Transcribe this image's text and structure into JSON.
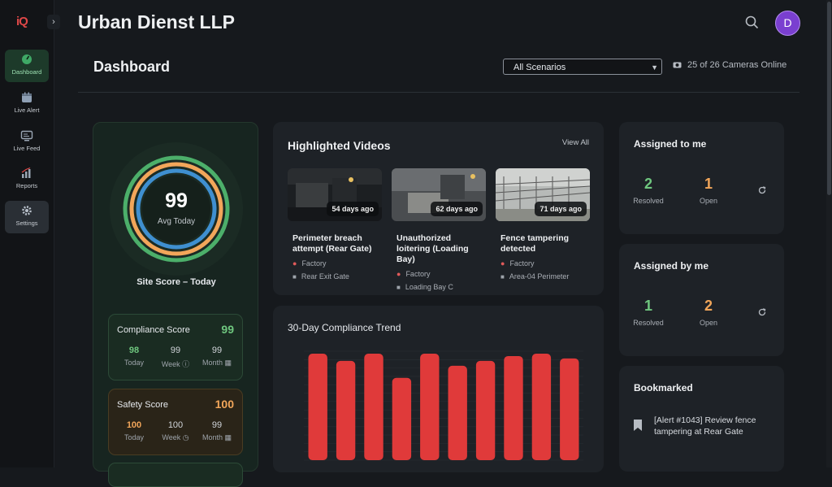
{
  "app": {
    "logo_text": "iQ",
    "company": "Urban Dienst LLP",
    "user_initial": "D"
  },
  "sidebar": {
    "items": [
      {
        "label": "Dashboard",
        "icon": "gauge-icon",
        "active": true
      },
      {
        "label": "Live Alert",
        "icon": "calendar-alert-icon"
      },
      {
        "label": "Live Feed",
        "icon": "monitor-icon"
      },
      {
        "label": "Reports",
        "icon": "bar-chart-icon"
      },
      {
        "label": "Settings",
        "icon": "gear-icon",
        "hover": true
      }
    ]
  },
  "page": {
    "title": "Dashboard",
    "scenario_selected": "All Scenarios",
    "cameras_online": "25 of 26 Cameras Online"
  },
  "site_score": {
    "value": "99",
    "sub": "Avg Today",
    "caption": "Site Score – Today",
    "rings": [
      {
        "color": "#4caf6a",
        "level": 0.99
      },
      {
        "color": "#f2a65a",
        "level": 1.0
      },
      {
        "color": "#3f8fd0",
        "level": 0.99
      }
    ]
  },
  "compliance": {
    "title": "Compliance Score",
    "value": "99",
    "today": "98",
    "today_label": "Today",
    "week": "99",
    "week_label": "Week",
    "month": "99",
    "month_label": "Month"
  },
  "safety": {
    "title": "Safety Score",
    "value": "100",
    "today": "100",
    "today_label": "Today",
    "week": "100",
    "week_label": "Week",
    "month": "99",
    "month_label": "Month"
  },
  "highlighted": {
    "title": "Highlighted Videos",
    "view_all": "View All",
    "videos": [
      {
        "age": "54 days ago",
        "title": "Perimeter breach attempt (Rear Gate)",
        "site": "Factory",
        "camera": "Rear Exit Gate"
      },
      {
        "age": "62 days ago",
        "title": "Unauthorized loitering (Loading Bay)",
        "site": "Factory",
        "camera": "Loading Bay C"
      },
      {
        "age": "71 days ago",
        "title": "Fence tampering detected",
        "site": "Factory",
        "camera": "Area-04 Perimeter"
      }
    ]
  },
  "trend": {
    "title": "30-Day Compliance Trend"
  },
  "chart_data": {
    "type": "bar",
    "title": "30-Day Compliance Trend",
    "values": [
      99,
      96,
      99,
      89,
      99,
      94,
      96,
      98,
      99,
      97
    ],
    "ylim": [
      0,
      100
    ],
    "color": "#e03a3a"
  },
  "assigned_to_me": {
    "title": "Assigned to me",
    "resolved": "2",
    "resolved_label": "Resolved",
    "open": "1",
    "open_label": "Open"
  },
  "assigned_by_me": {
    "title": "Assigned by me",
    "resolved": "1",
    "resolved_label": "Resolved",
    "open": "2",
    "open_label": "Open"
  },
  "bookmarked": {
    "title": "Bookmarked",
    "items": [
      {
        "text": "[Alert #1043] Review fence tampering at Rear Gate"
      }
    ]
  },
  "colors": {
    "accent_green": "#6fc77f",
    "accent_orange": "#f2a65a",
    "accent_blue": "#3f8fd0",
    "bar_red": "#e03a3a"
  }
}
